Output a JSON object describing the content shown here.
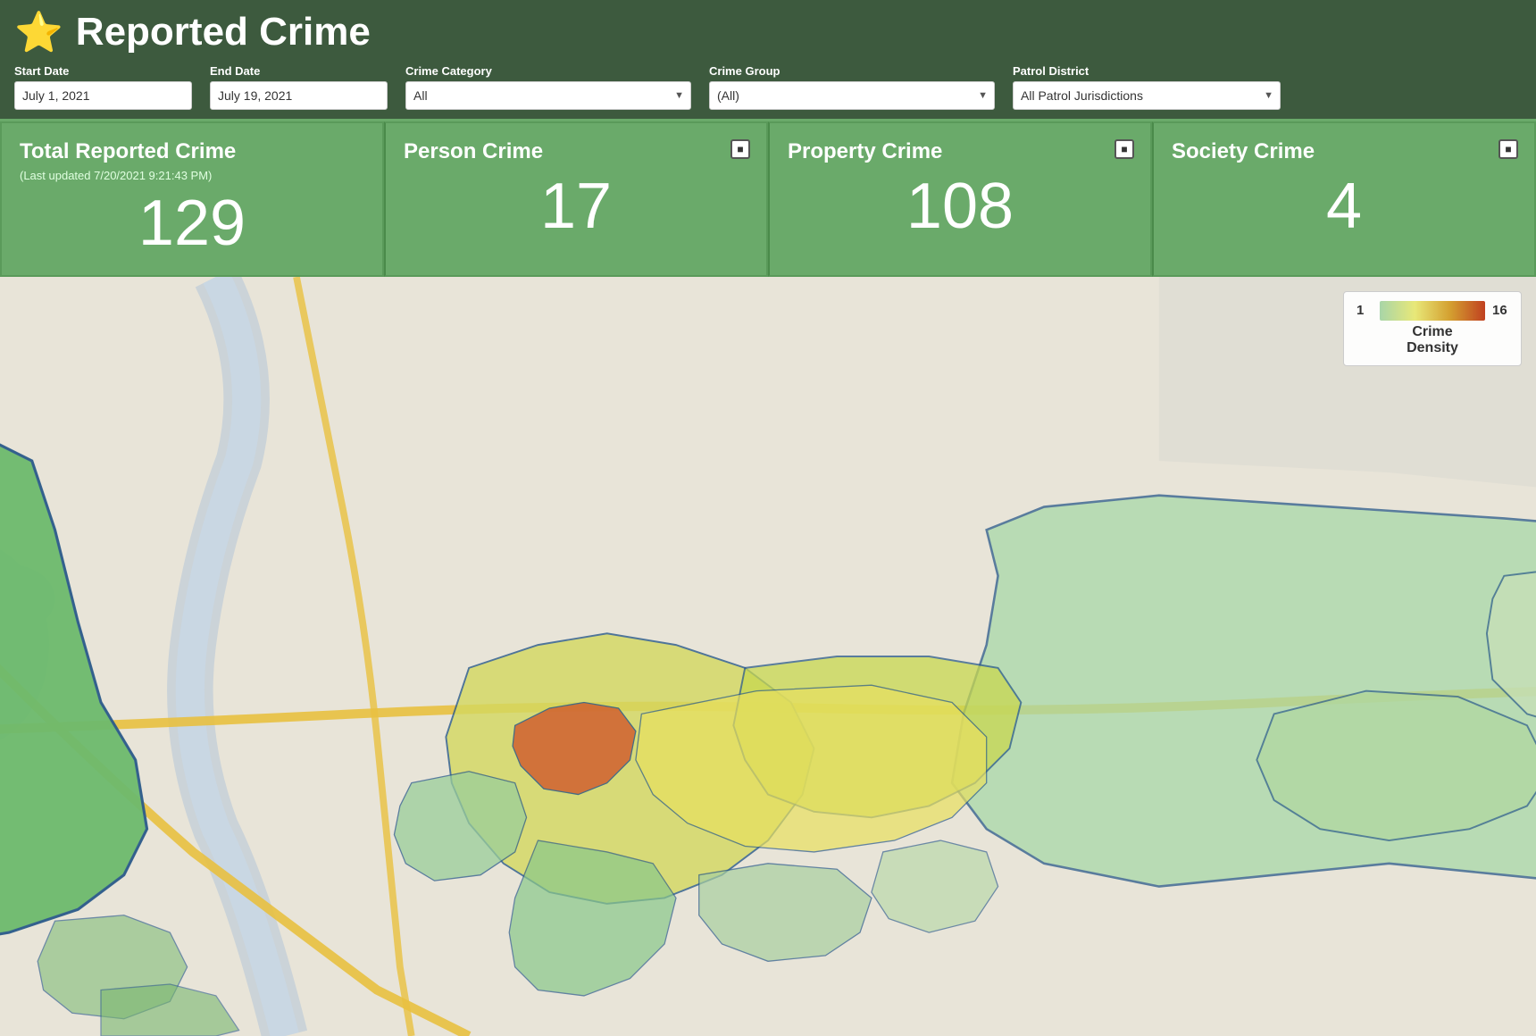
{
  "header": {
    "icon": "⭐",
    "title": "Reported Crime"
  },
  "filters": {
    "start_date_label": "Start Date",
    "start_date_value": "July 1, 2021",
    "end_date_label": "End Date",
    "end_date_value": "July 19, 2021",
    "crime_category_label": "Crime Category",
    "crime_category_value": "All",
    "crime_group_label": "Crime Group",
    "crime_group_value": "(All)",
    "patrol_district_label": "Patrol District",
    "patrol_district_value": "All Patrol Jurisdictions"
  },
  "stats": [
    {
      "title": "Total Reported Crime",
      "subtitle": "(Last updated 7/20/2021 9:21:43 PM)",
      "value": "129",
      "has_info": false
    },
    {
      "title": "Person Crime",
      "subtitle": "",
      "value": "17",
      "has_info": true
    },
    {
      "title": "Property Crime",
      "subtitle": "",
      "value": "108",
      "has_info": true
    },
    {
      "title": "Society Crime",
      "subtitle": "",
      "value": "4",
      "has_info": true
    }
  ],
  "legend": {
    "min_label": "1",
    "max_label": "16",
    "title_line1": "Crime",
    "title_line2": "Density"
  }
}
